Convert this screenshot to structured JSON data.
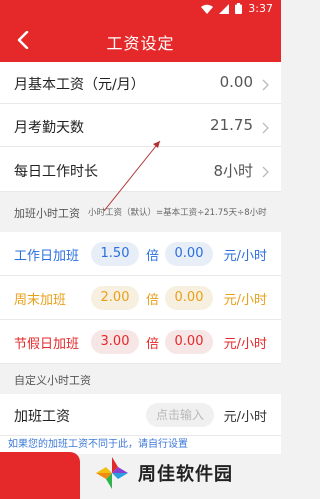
{
  "status": {
    "time": "3:37"
  },
  "header": {
    "title": "工资设定"
  },
  "rows": [
    {
      "label": "月基本工资（元/月）",
      "value": "0.00"
    },
    {
      "label": "月考勤天数",
      "value": "21.75"
    },
    {
      "label": "每日工作时长",
      "value": "8小时"
    }
  ],
  "overtime_section": {
    "title": "加班小时工资",
    "hint": "小时工资（默认）=基本工资÷21.75天÷8小时"
  },
  "overtime": [
    {
      "label": "工作日加班",
      "multiplier": "1.50",
      "times": "倍",
      "rate": "0.00",
      "unit": "元/小时",
      "color": "#2a6fe0"
    },
    {
      "label": "周末加班",
      "multiplier": "2.00",
      "times": "倍",
      "rate": "0.00",
      "unit": "元/小时",
      "color": "#e8a01a"
    },
    {
      "label": "节假日加班",
      "multiplier": "3.00",
      "times": "倍",
      "rate": "0.00",
      "unit": "元/小时",
      "color": "#e5292a"
    }
  ],
  "custom_section": {
    "title": "自定义小时工资"
  },
  "custom": {
    "label": "加班工资",
    "placeholder": "点击输入",
    "unit": "元/小时"
  },
  "tip": {
    "text": "如果您的加班工资不同于此，请自行设置"
  },
  "watermark": {
    "text": "周佳软件园"
  },
  "colors": {
    "brand": "#e5292a",
    "blue": "#2a6fe0",
    "orange": "#e8a01a"
  }
}
